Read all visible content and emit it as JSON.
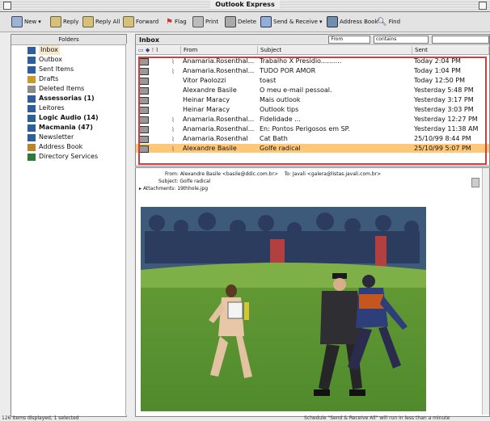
{
  "window": {
    "title": "Outlook Express"
  },
  "toolbar": {
    "buttons": [
      {
        "label": "New",
        "icon": "new-mail-icon"
      },
      {
        "label": "Reply",
        "icon": "reply-icon"
      },
      {
        "label": "Reply All",
        "icon": "reply-all-icon"
      },
      {
        "label": "Forward",
        "icon": "forward-icon"
      },
      {
        "label": "Flag",
        "icon": "flag-icon"
      },
      {
        "label": "Print",
        "icon": "print-icon"
      },
      {
        "label": "Delete",
        "icon": "delete-icon"
      },
      {
        "label": "Send & Receive",
        "icon": "send-receive-icon"
      },
      {
        "label": "Address Book",
        "icon": "address-book-icon"
      },
      {
        "label": "Find",
        "icon": "find-icon"
      }
    ]
  },
  "sidebar": {
    "header": "Folders",
    "items": [
      {
        "label": "Inbox",
        "bold": false,
        "selected": true
      },
      {
        "label": "Outbox",
        "bold": false
      },
      {
        "label": "Sent Items",
        "bold": false
      },
      {
        "label": "Drafts",
        "bold": false
      },
      {
        "label": "Deleted Items",
        "bold": false
      },
      {
        "label": "Assessorias (1)",
        "bold": true
      },
      {
        "label": "Leitores",
        "bold": false
      },
      {
        "label": "Logic Audio (14)",
        "bold": true
      },
      {
        "label": "Macmania (47)",
        "bold": true
      },
      {
        "label": "Newsletter",
        "bold": false
      },
      {
        "label": "Address Book",
        "bold": false
      },
      {
        "label": "Directory Services",
        "bold": false
      }
    ]
  },
  "messages": {
    "folder_title": "Inbox",
    "filter": {
      "field": "From",
      "op": "contains",
      "value": ""
    },
    "columns": {
      "from": "From",
      "subject": "Subject",
      "sent": "Sent"
    },
    "rows": [
      {
        "from": "Anamaria.Rosenthal...",
        "subject": "Trabalho X Presidio..........",
        "sent": "Today 2:04 PM",
        "attach": true
      },
      {
        "from": "Anamaria.Rosenthal...",
        "subject": "TUDO POR AMOR",
        "sent": "Today 1:04 PM",
        "attach": true
      },
      {
        "from": "Vitor Paolozzi",
        "subject": "toast",
        "sent": "Today 12:50 PM",
        "attach": false
      },
      {
        "from": "Alexandre Basile",
        "subject": "O meu e-mail pessoal.",
        "sent": "Yesterday 5:48 PM",
        "attach": false
      },
      {
        "from": "Heinar Maracy",
        "subject": "Mais outlook",
        "sent": "Yesterday 3:17 PM",
        "attach": false
      },
      {
        "from": "Heinar Maracy",
        "subject": "Outlook tips",
        "sent": "Yesterday 3:03 PM",
        "attach": false
      },
      {
        "from": "Anamaria.Rosenthal...",
        "subject": "Fidelidade ...",
        "sent": "Yesterday 12:27 PM",
        "attach": true
      },
      {
        "from": "Anamaria.Rosenthal...",
        "subject": "En: Pontos Perigosos em SP.",
        "sent": "Yesterday 11:38 AM",
        "attach": true
      },
      {
        "from": "Anamaria.Rosenthal",
        "subject": "Cat Bath",
        "sent": "25/10/99 8:44 PM",
        "attach": true
      },
      {
        "from": "Alexandre Basile",
        "subject": "Golfe radical",
        "sent": "25/10/99 5:07 PM",
        "attach": true,
        "selected": true
      }
    ]
  },
  "preview": {
    "from_label": "From:",
    "from": "Alexandre Basile <basile@ddic.com.br>",
    "to_label": "To:",
    "to": "Javali <galera@listas.javali.com.br>",
    "subject_label": "Subject:",
    "subject": "Golfe radical",
    "attachments_label": "Attachments:",
    "attachment": "19thhole.jpg"
  },
  "status": {
    "left": "126 items displayed, 1 selected",
    "right": "Schedule \"Send & Receive All\" will run in less than a minute"
  }
}
